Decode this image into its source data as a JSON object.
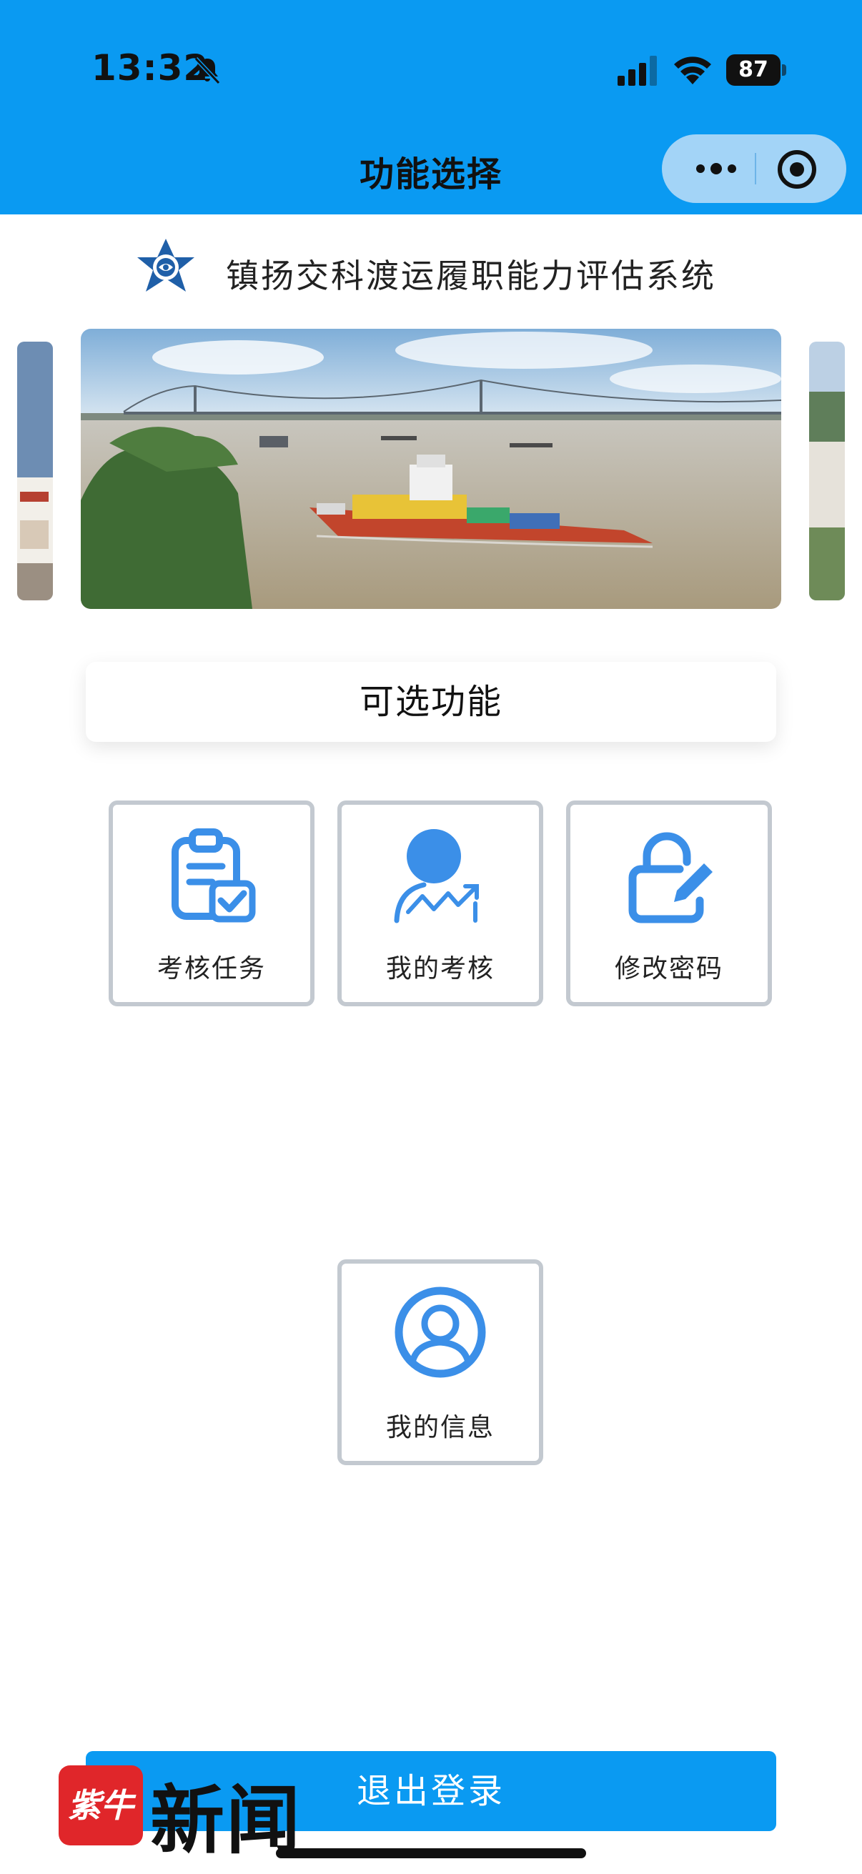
{
  "status_bar": {
    "time": "13:32",
    "battery": "87",
    "icons": [
      "bell-off-icon",
      "signal-icon",
      "wifi-icon",
      "battery-icon"
    ]
  },
  "nav": {
    "title": "功能选择",
    "capsule_icons": [
      "more-icon",
      "target-icon"
    ]
  },
  "app": {
    "title": "镇扬交科渡运履职能力评估系统"
  },
  "section": {
    "title": "可选功能"
  },
  "functions": [
    {
      "label": "考核任务",
      "icon": "task-checklist-icon"
    },
    {
      "label": "我的考核",
      "icon": "assessment-user-icon"
    },
    {
      "label": "修改密码",
      "icon": "lock-edit-icon"
    },
    {
      "label": "我的信息",
      "icon": "user-profile-icon"
    }
  ],
  "logout": {
    "label": "退出登录"
  },
  "watermark": {
    "badge": "紫牛",
    "text": "新闻"
  },
  "colors": {
    "primary": "#0a9af2",
    "icon_blue": "#3b8fe8",
    "tile_border": "#c3c9d0",
    "capsule": "#a3d4f7"
  }
}
